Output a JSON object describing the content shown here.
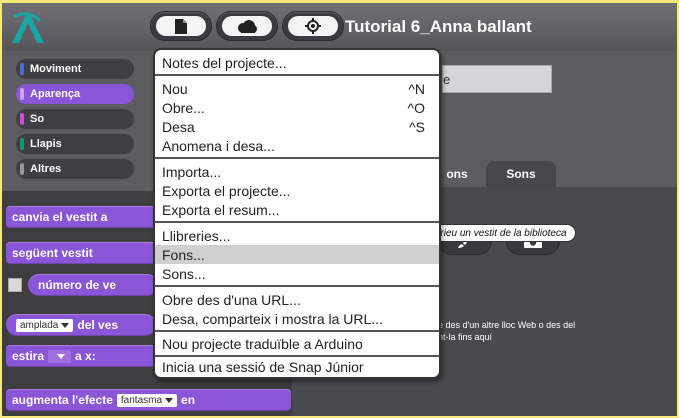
{
  "project": {
    "title": "Tutorial 6_Anna ballant"
  },
  "toolbar": {
    "file_icon": "file-icon",
    "cloud_icon": "cloud-icon",
    "settings_icon": "gear-icon"
  },
  "categories": [
    {
      "label": "Moviment",
      "color": "#4a6cd4"
    },
    {
      "label": "Aparença",
      "color": "#8a55d7"
    },
    {
      "label": "So",
      "color": "#cf4ad9"
    },
    {
      "label": "Llapis",
      "color": "#0e9a6c"
    },
    {
      "label": "Altres",
      "color": "#96969c"
    }
  ],
  "blocks": {
    "switch_costume": "canvia el vestit a",
    "next_costume": "següent vestit",
    "costume_number": "número de ve",
    "attr_slot": "amplada",
    "attr_rest": "del ves",
    "stretch": "estira",
    "stretch_x": "a x:",
    "effect_prefix": "augmenta l'efecte",
    "effect_slot": "fantasma",
    "effect_suffix": "en"
  },
  "tabs": [
    {
      "label": "ons"
    },
    {
      "label": "Sons"
    }
  ],
  "drop_hint": {
    "line1": "e des d'un altre lloc Web o des del",
    "line2": "nt-la fins aquí"
  },
  "tooltip": "Trieu un vestit de la biblioteca",
  "menu": {
    "items": [
      {
        "label": "Notes del projecte...",
        "shortcut": ""
      },
      {
        "label": "Nou",
        "shortcut": "^N"
      },
      {
        "label": "Obre...",
        "shortcut": "^O"
      },
      {
        "label": "Desa",
        "shortcut": "^S"
      },
      {
        "label": "Anomena i desa...",
        "shortcut": ""
      },
      {
        "label": "Importa...",
        "shortcut": ""
      },
      {
        "label": "Exporta el projecte...",
        "shortcut": ""
      },
      {
        "label": "Exporta el resum...",
        "shortcut": ""
      },
      {
        "label": "Llibreries...",
        "shortcut": ""
      },
      {
        "label": "Fons...",
        "shortcut": "",
        "highlighted": true
      },
      {
        "label": "Sons...",
        "shortcut": ""
      },
      {
        "label": "Obre des d'una URL...",
        "shortcut": ""
      },
      {
        "label": "Desa, comparteix i mostra la URL...",
        "shortcut": ""
      },
      {
        "label": "Nou projecte traduïble a Arduino",
        "shortcut": ""
      },
      {
        "label": "Inicia una sessió de Snap Júnior",
        "shortcut": ""
      }
    ]
  },
  "colors": {
    "accent": "#8a55d7",
    "outer_background": "#f7e87a",
    "menu_highlight": "#cfcfcf"
  }
}
